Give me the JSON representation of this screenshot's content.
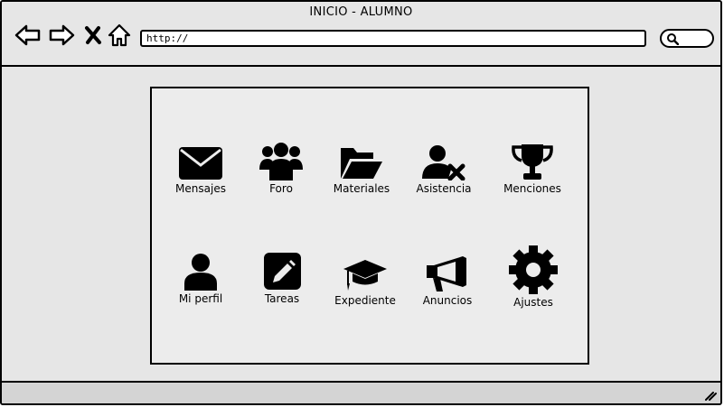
{
  "window": {
    "title": "INICIO - ALUMNO"
  },
  "toolbar": {
    "back_icon": "arrow-left-icon",
    "forward_icon": "arrow-right-icon",
    "stop_icon": "close-icon",
    "home_icon": "home-icon",
    "url_value": "http://",
    "search_icon": "search-icon"
  },
  "menu": {
    "items": [
      {
        "label": "Mensajes",
        "icon": "envelope-icon"
      },
      {
        "label": "Foro",
        "icon": "users-icon"
      },
      {
        "label": "Materiales",
        "icon": "folder-open-icon"
      },
      {
        "label": "Asistencia",
        "icon": "user-times-icon"
      },
      {
        "label": "Menciones",
        "icon": "trophy-icon"
      },
      {
        "label": "Mi perfil",
        "icon": "user-icon"
      },
      {
        "label": "Tareas",
        "icon": "pencil-square-icon"
      },
      {
        "label": "Expediente",
        "icon": "graduation-cap-icon"
      },
      {
        "label": "Anuncios",
        "icon": "bullhorn-icon"
      },
      {
        "label": "Ajustes",
        "icon": "gear-icon"
      }
    ]
  },
  "colors": {
    "background": "#e6e6e6",
    "panel": "#ececec",
    "stroke": "#000000",
    "statusbar": "#d4d4d4"
  }
}
